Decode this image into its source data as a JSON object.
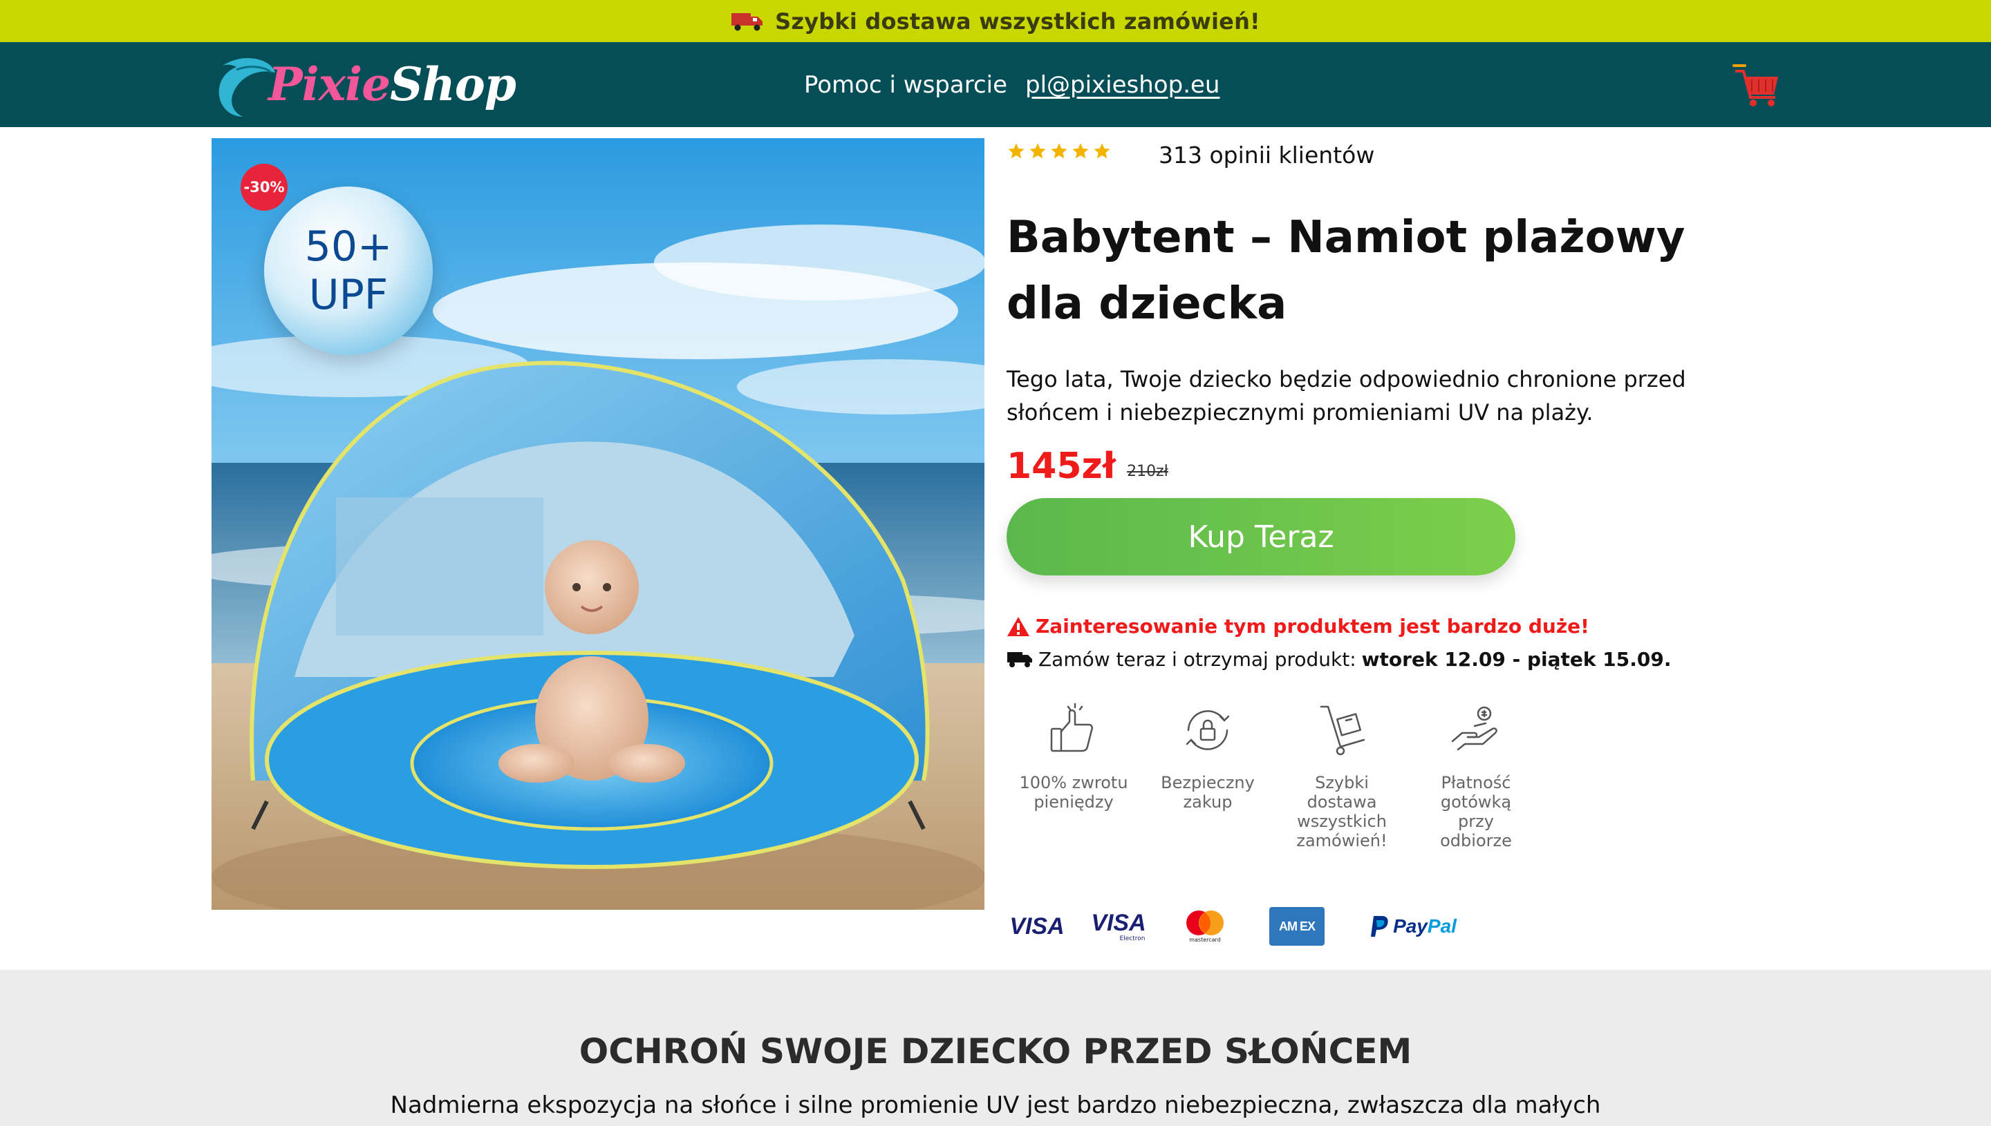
{
  "topbar": {
    "text": "Szybki dostawa wszystkich zamówień!",
    "bg_color": "#c8d700"
  },
  "header": {
    "bg_color": "#064e57",
    "logo": {
      "part1": "Pixie",
      "part2": "Shop"
    },
    "nav": {
      "help": "Pomoc i wsparcie",
      "email": "pl@pixieshop.eu"
    },
    "cart_icon": "cart-icon"
  },
  "product": {
    "badge": "-30%",
    "upf": {
      "line1": "50+",
      "line2": "UPF"
    },
    "stars": 5,
    "reviews": "313 opinii klientów",
    "title": "Babytent – Namiot plażowy dla dziecka",
    "description": "Tego lata, Twoje dziecko będzie odpowiednio chronione przed słońcem i niebezpiecznymi promieniami UV na plaży.",
    "price": "145zł",
    "old_price": "210zł",
    "buy_label": "Kup Teraz",
    "alert": "Zainteresowanie tym produktem jest bardzo duże!",
    "delivery_prefix": "Zamów teraz i otrzymaj produkt:",
    "delivery_dates": "wtorek 12.09 - piątek 15.09.",
    "accent_red": "#ef1a1a",
    "accent_green": "#6cc24a"
  },
  "features": [
    {
      "icon": "thumbs-up-icon",
      "label": "100% zwrotu pieniędzy"
    },
    {
      "icon": "secure-lock-icon",
      "label": "Bezpieczny zakup"
    },
    {
      "icon": "hand-truck-icon",
      "label": "Szybki dostawa wszystkich zamówień!"
    },
    {
      "icon": "cash-hand-icon",
      "label": "Płatność gotówką przy odbiorze"
    }
  ],
  "payments": {
    "visa": "VISA",
    "visa_electron": "VISA",
    "visa_electron_sub": "Electron",
    "mastercard": "mastercard",
    "amex": "AM EX",
    "paypal_a": "Pay",
    "paypal_b": "Pal"
  },
  "section": {
    "title": "OCHROŃ SWOJE DZIECKO PRZED SŁOŃCEM",
    "text": "Nadmierna ekspozycja na słońce i silne promienie UV jest bardzo niebezpieczna, zwłaszcza dla małych"
  }
}
